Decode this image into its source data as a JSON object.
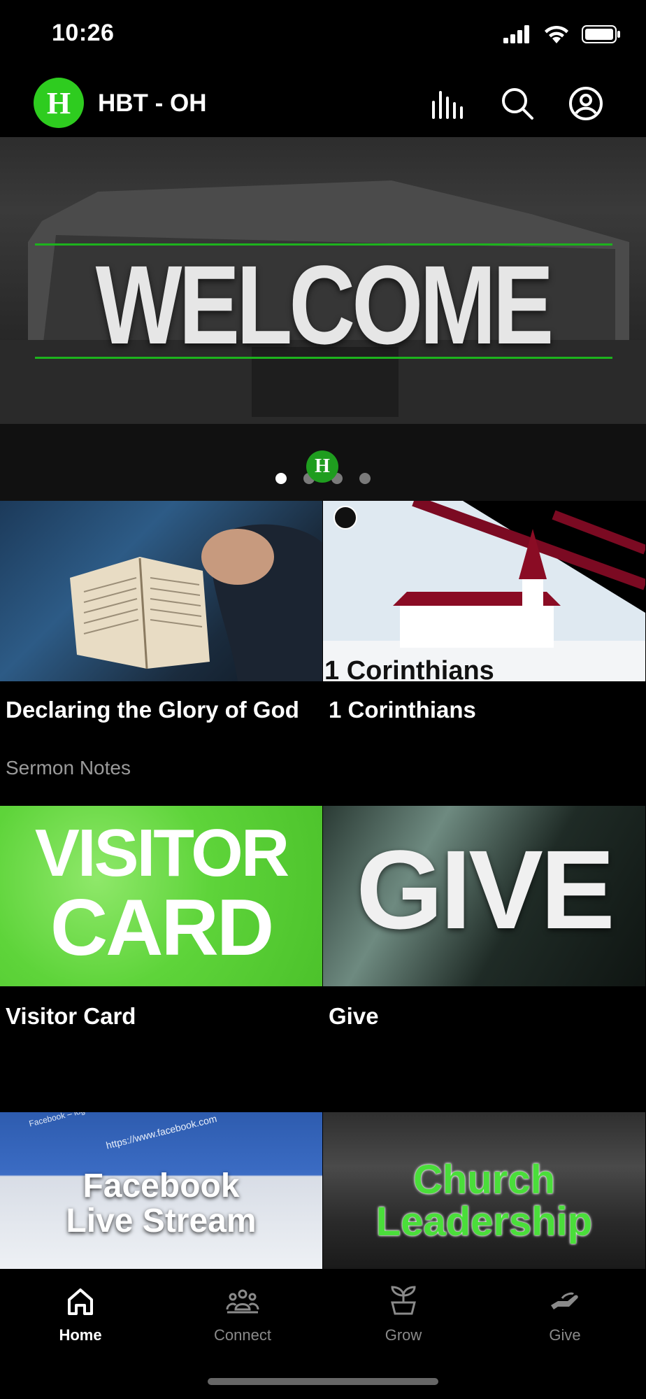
{
  "status": {
    "time": "10:26"
  },
  "header": {
    "title": "HBT - OH",
    "logo_letter": "H"
  },
  "hero": {
    "text": "WELCOME",
    "slides": 4,
    "active_slide": 0
  },
  "cards": [
    {
      "title": "Declaring the Glory of God",
      "subtitle": "Sermon Notes"
    },
    {
      "title": "1 Corinthians",
      "image_text": "1 Corinthians"
    },
    {
      "title": "Visitor Card",
      "image_text_line1": "VISITOR",
      "image_text_line2": "CARD"
    },
    {
      "title": "Give",
      "image_text": "GIVE"
    },
    {
      "image_text_line1": "Facebook",
      "image_text_line2": "Live Stream",
      "url_text": "https://www.facebook.com",
      "tab_text": "Facebook – log in or sign up"
    },
    {
      "image_text_line1": "Church",
      "image_text_line2": "Leadership"
    }
  ],
  "tabs": [
    {
      "label": "Home",
      "icon": "home-icon"
    },
    {
      "label": "Connect",
      "icon": "people-icon"
    },
    {
      "label": "Grow",
      "icon": "sprout-icon"
    },
    {
      "label": "Give",
      "icon": "giving-hand-icon"
    }
  ],
  "colors": {
    "brand_green": "#2ecc1f",
    "background": "#000000",
    "inactive_tab": "#8a8a8a"
  }
}
